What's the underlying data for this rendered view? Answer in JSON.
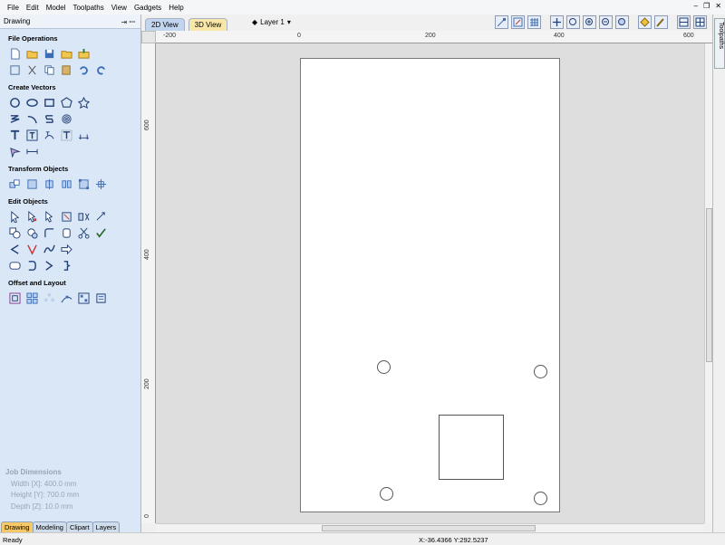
{
  "menubar": {
    "items": [
      "File",
      "Edit",
      "Model",
      "Toolpaths",
      "View",
      "Gadgets",
      "Help"
    ]
  },
  "left_panel": {
    "title": "Drawing",
    "sections": [
      {
        "title": "File Operations"
      },
      {
        "title": "Create Vectors"
      },
      {
        "title": "Transform Objects"
      },
      {
        "title": "Edit Objects"
      },
      {
        "title": "Offset and Layout"
      }
    ],
    "job_dimensions": {
      "title": "Job Dimensions",
      "width": "Width  [X]: 400.0 mm",
      "height": "Height [Y]: 700.0 mm",
      "depth": "Depth  [Z]: 10.0 mm"
    },
    "tabs": [
      "Drawing",
      "Modeling",
      "Clipart",
      "Layers"
    ]
  },
  "view_bar": {
    "tabs": [
      "2D View",
      "3D View"
    ],
    "layer_label": "Layer 1",
    "tool_icons": [
      "vector-select-icon",
      "node-edit-icon",
      "grid-icon",
      "pan-icon",
      "zoom-box-icon",
      "zoom-in-icon",
      "zoom-out-icon",
      "zoom-fit-icon",
      "snap-icon",
      "toolpath-icon",
      "split-view-icon",
      "layout-icon"
    ]
  },
  "rulers": {
    "top_labels": [
      "-200",
      "0",
      "200",
      "400",
      "600"
    ],
    "left_labels": [
      "600",
      "400",
      "200",
      "0"
    ]
  },
  "right_sidebar": {
    "tab_label": "Toolpaths"
  },
  "statusbar": {
    "status": "Ready",
    "coords": "X:-36.4366 Y:292.5237"
  },
  "colors": {
    "panel_bg": "#d9e7f7",
    "active_tab": "#f6c868",
    "canvas_bg": "#dedede"
  }
}
